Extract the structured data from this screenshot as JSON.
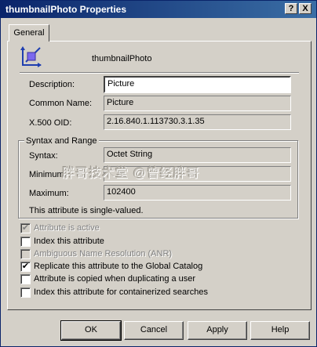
{
  "window": {
    "title": "thumbnailPhoto Properties",
    "help_button": "?",
    "close_button": "X"
  },
  "tabs": [
    {
      "label": "General",
      "selected": true
    }
  ],
  "header": {
    "attribute_name": "thumbnailPhoto",
    "icon": "attribute-icon"
  },
  "fields": {
    "description": {
      "label": "Description:",
      "value": "Picture"
    },
    "common_name": {
      "label": "Common Name:",
      "value": "Picture"
    },
    "oid": {
      "label": "X.500 OID:",
      "value": "2.16.840.1.113730.3.1.35"
    }
  },
  "syntax_group": {
    "title": "Syntax and Range",
    "syntax": {
      "label": "Syntax:",
      "value": "Octet String"
    },
    "minimum": {
      "label": "Minimum:",
      "value": ""
    },
    "maximum": {
      "label": "Maximum:",
      "value": "102400"
    },
    "note": "This attribute is single-valued."
  },
  "watermark": "胖哥技术堂 @曾经胖哥",
  "checkboxes": [
    {
      "label": "Attribute is active",
      "checked": true,
      "disabled": true
    },
    {
      "label": "Index this attribute",
      "checked": false,
      "disabled": false
    },
    {
      "label": "Ambiguous Name Resolution (ANR)",
      "checked": false,
      "disabled": true
    },
    {
      "label": "Replicate this attribute to the Global Catalog",
      "checked": true,
      "disabled": false
    },
    {
      "label": "Attribute is copied when duplicating a user",
      "checked": false,
      "disabled": false
    },
    {
      "label": "Index this attribute for containerized searches",
      "checked": false,
      "disabled": false
    }
  ],
  "buttons": {
    "ok": "OK",
    "cancel": "Cancel",
    "apply": "Apply",
    "help": "Help"
  },
  "colors": {
    "titlebar": "#0a246a",
    "face": "#d4d0c8",
    "icon_accent": "#7b68ee"
  }
}
